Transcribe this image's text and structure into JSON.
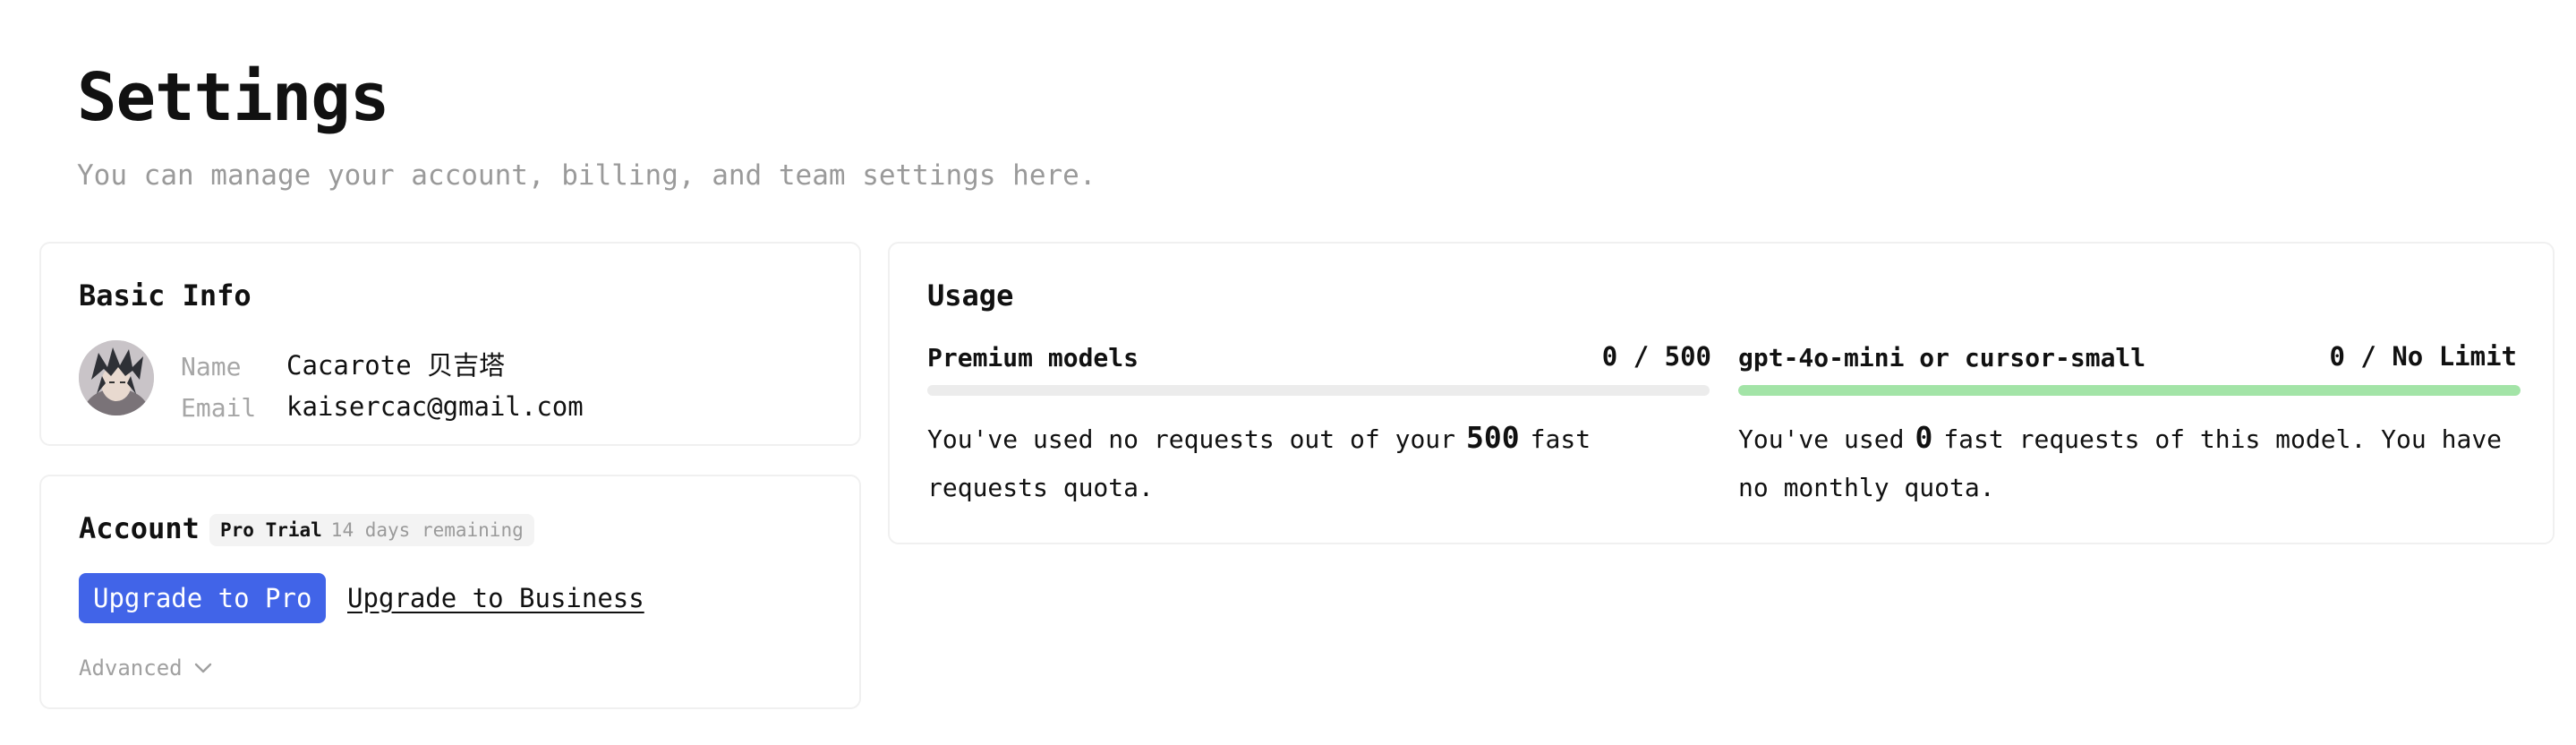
{
  "page": {
    "title": "Settings",
    "subtitle": "You can manage your account, billing, and team settings here."
  },
  "basic_info": {
    "title": "Basic Info",
    "name_label": "Name",
    "name_value": "Cacarote 贝吉塔",
    "email_label": "Email",
    "email_value": "kaisercac@gmail.com"
  },
  "account": {
    "title": "Account",
    "plan": "Pro Trial",
    "plan_remaining": "14 days remaining",
    "upgrade_pro_label": "Upgrade to Pro",
    "upgrade_business_label": "Upgrade to Business",
    "advanced_label": "Advanced",
    "advanced_icon": "chevron-down-icon"
  },
  "usage": {
    "title": "Usage",
    "meters": [
      {
        "label": "Premium models",
        "count": "0 / 500",
        "fill_fraction": 0,
        "fill_color": "#ececec",
        "text_before": "You've used no requests out of your",
        "number": "500",
        "text_after": "fast requests quota."
      },
      {
        "label": "gpt-4o-mini or cursor-small",
        "count": "0 / No Limit",
        "fill_fraction": 1,
        "fill_color": "#a3e4a7",
        "text_before": "You've used",
        "number": "0",
        "text_after": "fast requests of this model. You have no monthly quota."
      }
    ]
  },
  "colors": {
    "accent": "#4164e8",
    "muted_text": "#9a9a9a",
    "card_border": "#f0f0f0"
  }
}
